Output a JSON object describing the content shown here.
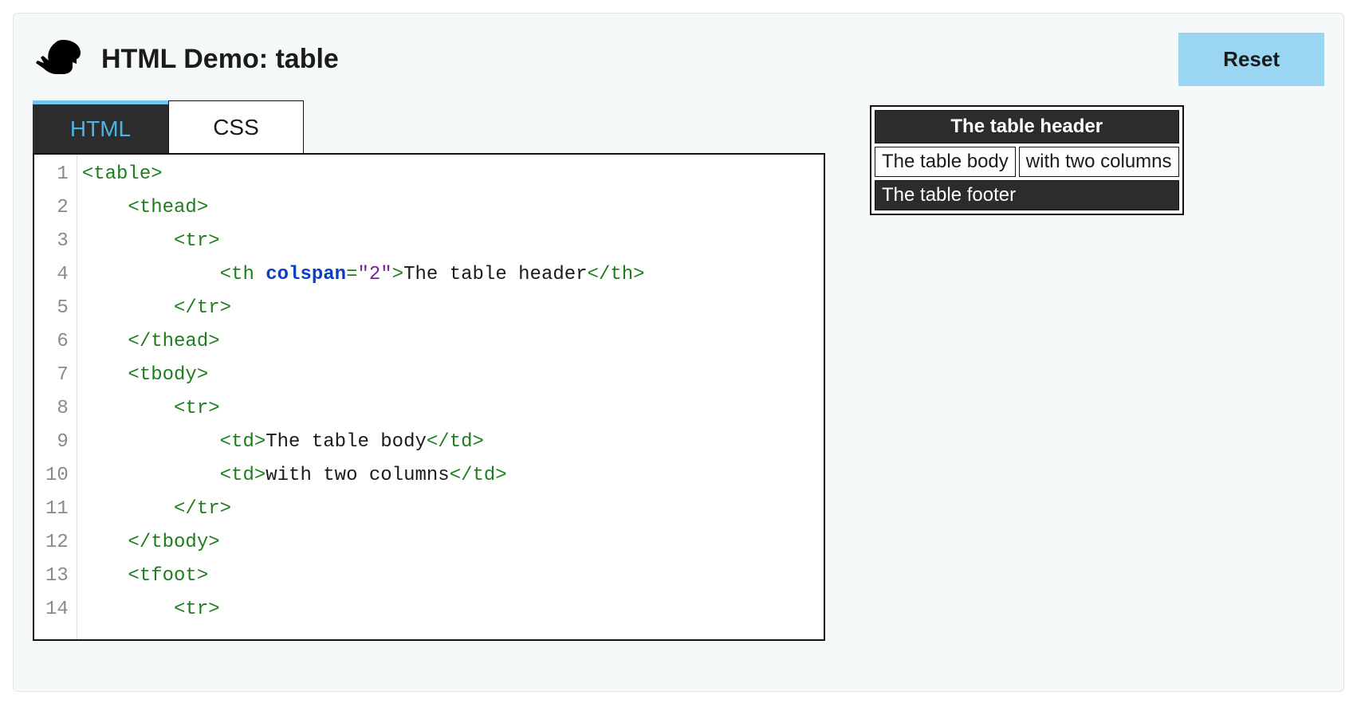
{
  "header": {
    "title": "HTML Demo: table",
    "reset_label": "Reset",
    "icon_name": "dino-icon"
  },
  "tabs": {
    "html_label": "HTML",
    "css_label": "CSS",
    "active": "html"
  },
  "editor": {
    "language": "html",
    "line_count": 14,
    "line_numbers": [
      "1",
      "2",
      "3",
      "4",
      "5",
      "6",
      "7",
      "8",
      "9",
      "10",
      "11",
      "12",
      "13",
      "14"
    ],
    "lines": [
      [
        {
          "t": "tag",
          "v": "<table>"
        }
      ],
      [
        {
          "t": "pad",
          "v": "    "
        },
        {
          "t": "tag",
          "v": "<thead>"
        }
      ],
      [
        {
          "t": "pad",
          "v": "        "
        },
        {
          "t": "tag",
          "v": "<tr>"
        }
      ],
      [
        {
          "t": "pad",
          "v": "            "
        },
        {
          "t": "tag",
          "v": "<th "
        },
        {
          "t": "attr",
          "v": "colspan"
        },
        {
          "t": "tag",
          "v": "="
        },
        {
          "t": "str",
          "v": "\"2\""
        },
        {
          "t": "tag",
          "v": ">"
        },
        {
          "t": "text",
          "v": "The table header"
        },
        {
          "t": "tag",
          "v": "</th>"
        }
      ],
      [
        {
          "t": "pad",
          "v": "        "
        },
        {
          "t": "tag",
          "v": "</tr>"
        }
      ],
      [
        {
          "t": "pad",
          "v": "    "
        },
        {
          "t": "tag",
          "v": "</thead>"
        }
      ],
      [
        {
          "t": "pad",
          "v": "    "
        },
        {
          "t": "tag",
          "v": "<tbody>"
        }
      ],
      [
        {
          "t": "pad",
          "v": "        "
        },
        {
          "t": "tag",
          "v": "<tr>"
        }
      ],
      [
        {
          "t": "pad",
          "v": "            "
        },
        {
          "t": "tag",
          "v": "<td>"
        },
        {
          "t": "text",
          "v": "The table body"
        },
        {
          "t": "tag",
          "v": "</td>"
        }
      ],
      [
        {
          "t": "pad",
          "v": "            "
        },
        {
          "t": "tag",
          "v": "<td>"
        },
        {
          "t": "text",
          "v": "with two columns"
        },
        {
          "t": "tag",
          "v": "</td>"
        }
      ],
      [
        {
          "t": "pad",
          "v": "        "
        },
        {
          "t": "tag",
          "v": "</tr>"
        }
      ],
      [
        {
          "t": "pad",
          "v": "    "
        },
        {
          "t": "tag",
          "v": "</tbody>"
        }
      ],
      [
        {
          "t": "pad",
          "v": "    "
        },
        {
          "t": "tag",
          "v": "<tfoot>"
        }
      ],
      [
        {
          "t": "pad",
          "v": "        "
        },
        {
          "t": "tag",
          "v": "<tr>"
        }
      ]
    ]
  },
  "preview": {
    "header_text": "The table header",
    "body_cells": [
      "The table body",
      "with two columns"
    ],
    "footer_text": "The table footer"
  }
}
